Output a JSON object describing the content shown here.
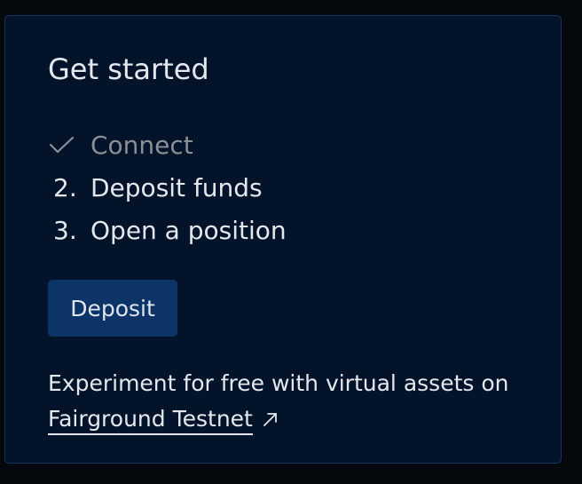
{
  "card": {
    "title": "Get started",
    "steps": [
      {
        "marker": "check",
        "label": "Connect",
        "state": "done"
      },
      {
        "marker": "2.",
        "label": "Deposit funds",
        "state": "pending"
      },
      {
        "marker": "3.",
        "label": "Open a position",
        "state": "pending"
      }
    ],
    "deposit_button": "Deposit",
    "footer_text": "Experiment for free with virtual assets on",
    "footer_link": "Fairground Testnet",
    "footer_link_icon": "external-link-arrow-icon"
  },
  "colors": {
    "page_background": "#05080d",
    "card_background": "#02132a",
    "card_border": "#17325e",
    "text": "#e4e8ee",
    "completed_text": "#8b8f96",
    "button_background": "#0c3466"
  }
}
